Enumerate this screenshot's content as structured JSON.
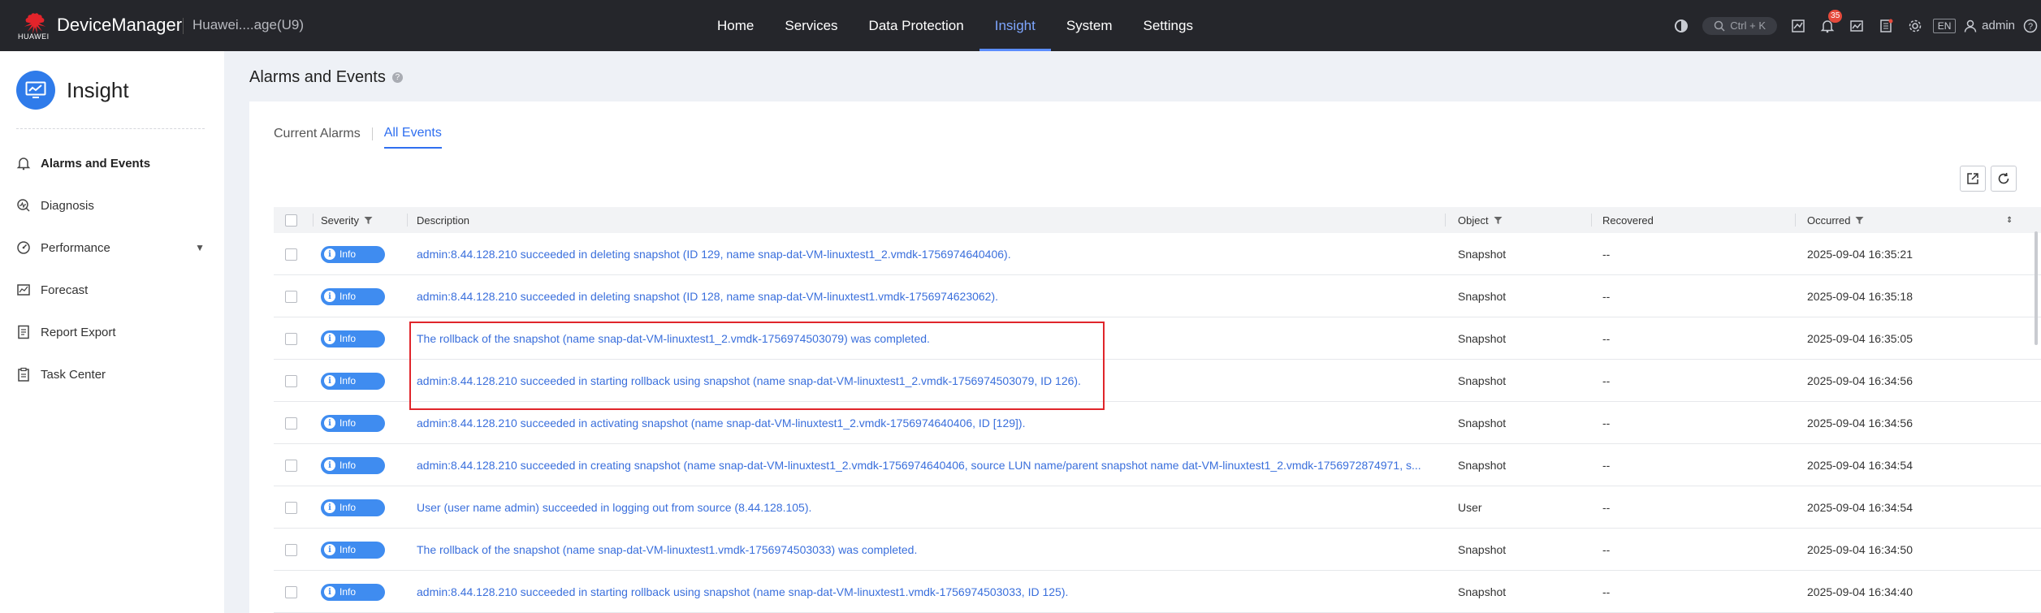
{
  "topbar": {
    "brand": "HUAWEI",
    "app_name": "DeviceManager",
    "device": "Huawei....age(U9)",
    "nav": [
      "Home",
      "Services",
      "Data Protection",
      "Insight",
      "System",
      "Settings"
    ],
    "search_shortcut": "Ctrl + K",
    "alarm_count": "35",
    "lang": "EN",
    "user": "admin"
  },
  "sidebar": {
    "title": "Insight",
    "items": [
      {
        "label": "Alarms and Events",
        "icon": "bell-icon"
      },
      {
        "label": "Diagnosis",
        "icon": "diagnosis-icon"
      },
      {
        "label": "Performance",
        "icon": "gauge-icon"
      },
      {
        "label": "Forecast",
        "icon": "chart-icon"
      },
      {
        "label": "Report Export",
        "icon": "report-icon"
      },
      {
        "label": "Task Center",
        "icon": "clipboard-icon"
      }
    ]
  },
  "main": {
    "title": "Alarms and Events",
    "tabs": [
      "Current Alarms",
      "All Events"
    ],
    "columns": [
      "Severity",
      "Description",
      "Object",
      "Recovered",
      "Occurred"
    ],
    "rows": [
      {
        "severity": "Info",
        "description": "admin:8.44.128.210 succeeded in deleting snapshot (ID 129, name snap-dat-VM-linuxtest1_2.vmdk-1756974640406).",
        "object": "Snapshot",
        "recovered": "--",
        "occurred": "2025-09-04 16:35:21"
      },
      {
        "severity": "Info",
        "description": "admin:8.44.128.210 succeeded in deleting snapshot (ID 128, name snap-dat-VM-linuxtest1.vmdk-1756974623062).",
        "object": "Snapshot",
        "recovered": "--",
        "occurred": "2025-09-04 16:35:18"
      },
      {
        "severity": "Info",
        "description": "The rollback of the snapshot (name snap-dat-VM-linuxtest1_2.vmdk-1756974503079) was completed.",
        "object": "Snapshot",
        "recovered": "--",
        "occurred": "2025-09-04 16:35:05"
      },
      {
        "severity": "Info",
        "description": "admin:8.44.128.210 succeeded in starting rollback using snapshot (name snap-dat-VM-linuxtest1_2.vmdk-1756974503079, ID 126).",
        "object": "Snapshot",
        "recovered": "--",
        "occurred": "2025-09-04 16:34:56"
      },
      {
        "severity": "Info",
        "description": "admin:8.44.128.210 succeeded in activating snapshot (name snap-dat-VM-linuxtest1_2.vmdk-1756974640406, ID [129]).",
        "object": "Snapshot",
        "recovered": "--",
        "occurred": "2025-09-04 16:34:56"
      },
      {
        "severity": "Info",
        "description": "admin:8.44.128.210 succeeded in creating snapshot (name snap-dat-VM-linuxtest1_2.vmdk-1756974640406, source LUN name/parent snapshot name dat-VM-linuxtest1_2.vmdk-1756972874971, s...",
        "object": "Snapshot",
        "recovered": "--",
        "occurred": "2025-09-04 16:34:54"
      },
      {
        "severity": "Info",
        "description": "User (user name admin) succeeded in logging out from source (8.44.128.105).",
        "object": "User",
        "recovered": "--",
        "occurred": "2025-09-04 16:34:54"
      },
      {
        "severity": "Info",
        "description": "The rollback of the snapshot (name snap-dat-VM-linuxtest1.vmdk-1756974503033) was completed.",
        "object": "Snapshot",
        "recovered": "--",
        "occurred": "2025-09-04 16:34:50"
      },
      {
        "severity": "Info",
        "description": "admin:8.44.128.210 succeeded in starting rollback using snapshot (name snap-dat-VM-linuxtest1.vmdk-1756974503033, ID 125).",
        "object": "Snapshot",
        "recovered": "--",
        "occurred": "2025-09-04 16:34:40"
      }
    ]
  },
  "colors": {
    "accent": "#2f6ff0",
    "severity_info": "#3f8cf0",
    "highlight": "#e0252b",
    "topbar": "#25262b"
  }
}
